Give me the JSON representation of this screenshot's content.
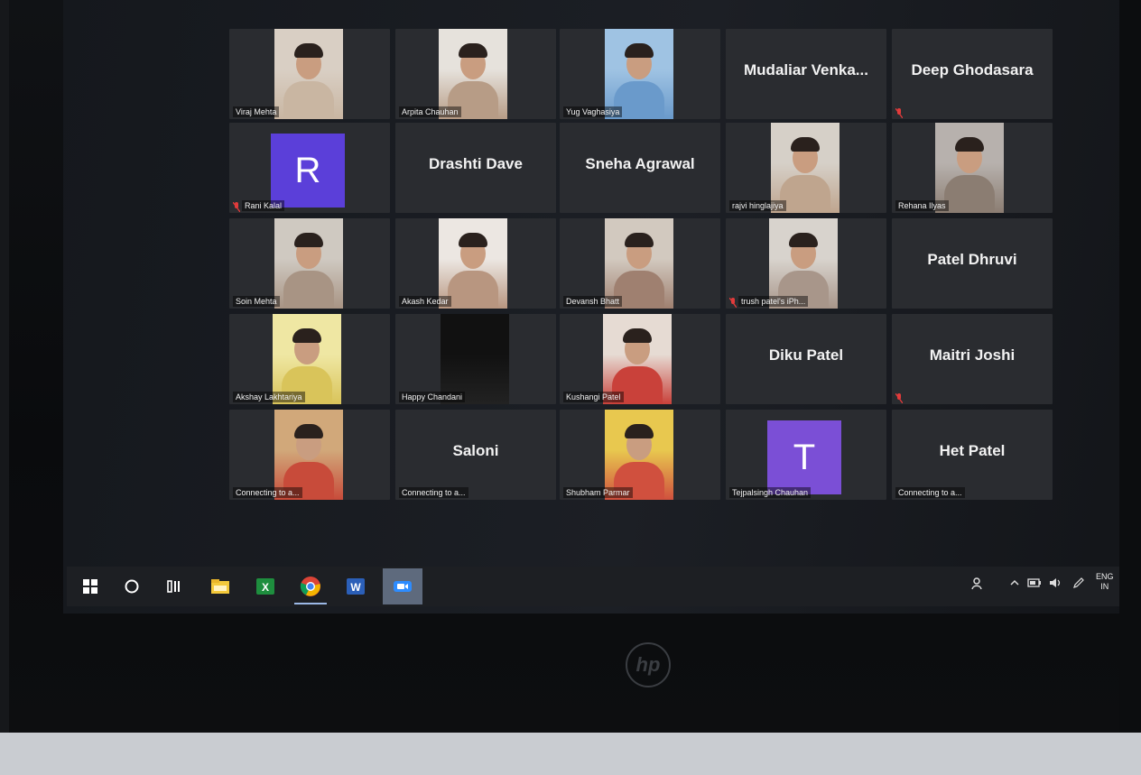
{
  "participants": [
    {
      "name": "Viraj Mehta",
      "display": "video",
      "muted": false
    },
    {
      "name": "Arpita Chauhan",
      "display": "video",
      "muted": false
    },
    {
      "name": "Yug Vaghasiya",
      "display": "video",
      "muted": false
    },
    {
      "name": "Mudaliar  Venka...",
      "display": "name",
      "muted": false
    },
    {
      "name": "Deep Ghodasara",
      "display": "name",
      "muted": true
    },
    {
      "name": "Rani Kalal",
      "display": "avatar",
      "avatar_letter": "R",
      "avatar_color": "#5b3fd9",
      "muted": true
    },
    {
      "name": "Drashti Dave",
      "display": "name",
      "muted": false
    },
    {
      "name": "Sneha Agrawal",
      "display": "name",
      "muted": false
    },
    {
      "name": "rajvi hinglajiya",
      "display": "video",
      "muted": false
    },
    {
      "name": "Rehana Ilyas",
      "display": "video",
      "muted": false
    },
    {
      "name": "Soin Mehta",
      "display": "video",
      "muted": false
    },
    {
      "name": "Akash Kedar",
      "display": "video",
      "muted": false
    },
    {
      "name": "Devansh Bhatt",
      "display": "video",
      "muted": false
    },
    {
      "name": "trush patel's iPh...",
      "display": "video",
      "muted": true
    },
    {
      "name": "Patel Dhruvi",
      "display": "name",
      "muted": false
    },
    {
      "name": "Akshay Lakhtariya",
      "display": "video",
      "muted": false
    },
    {
      "name": "Happy Chandani",
      "display": "video",
      "muted": false
    },
    {
      "name": "Kushangi Patel",
      "display": "video",
      "muted": false
    },
    {
      "name": "Diku Patel",
      "display": "name",
      "muted": false
    },
    {
      "name": "Maitri Joshi",
      "display": "name",
      "muted": true
    },
    {
      "name": "Connecting to a...",
      "display": "video",
      "muted": false
    },
    {
      "name": "Saloni",
      "display": "name",
      "status": "Connecting to a...",
      "muted": false
    },
    {
      "name": "Shubham Parmar",
      "display": "video",
      "muted": false
    },
    {
      "name": "Tejpalsingh Chauhan",
      "display": "avatar",
      "avatar_letter": "T",
      "avatar_color": "#7b4fd6",
      "muted": false
    },
    {
      "name": "Het Patel",
      "display": "name",
      "status": "Connecting to a...",
      "muted": false
    }
  ],
  "taskbar": {
    "apps": [
      "start-icon",
      "cortana-icon",
      "task-view-icon",
      "file-explorer-icon",
      "excel-icon",
      "chrome-icon",
      "word-icon",
      "zoom-icon"
    ],
    "active": "zoom-icon",
    "tray_lang_line1": "ENG",
    "tray_lang_line2": "IN"
  },
  "monitor_brand": "hp"
}
